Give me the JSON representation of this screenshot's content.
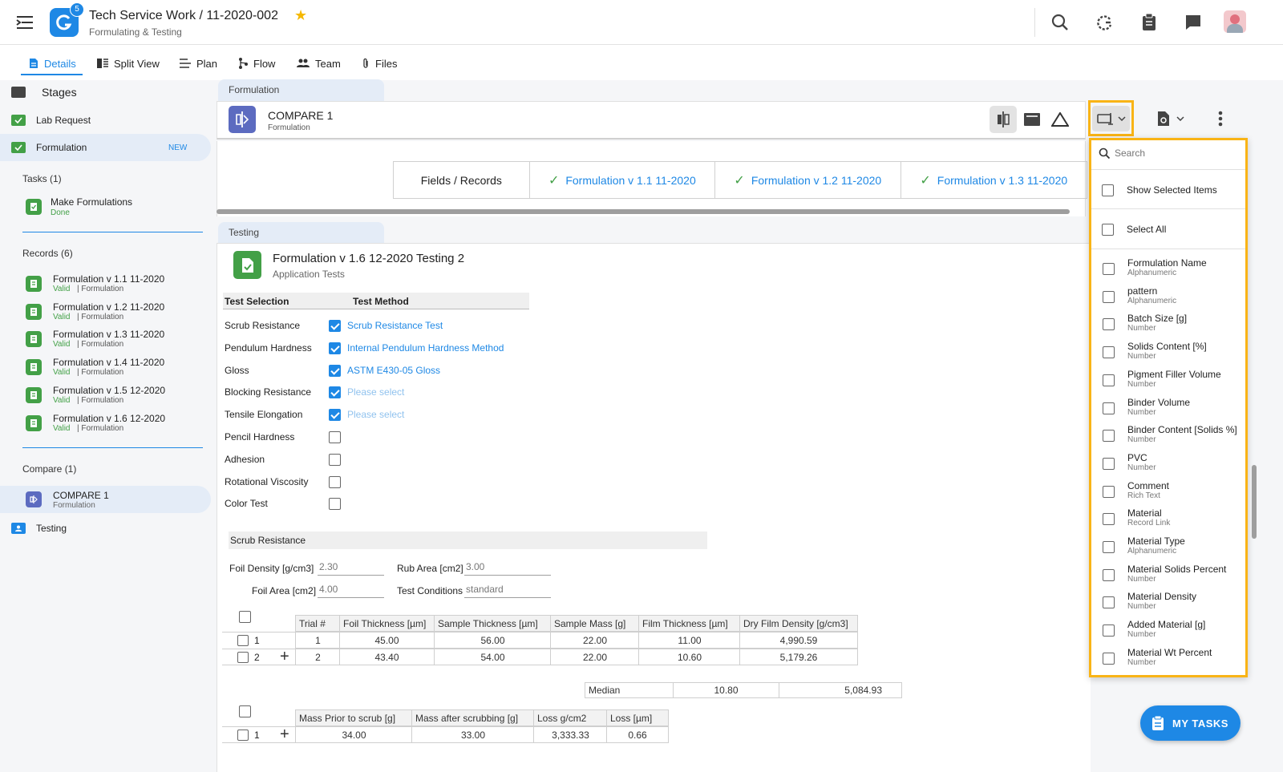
{
  "app": {
    "title": "Tech Service Work / 11-2020-002",
    "subtitle": "Formulating & Testing",
    "notification_count": "5"
  },
  "tabs": [
    {
      "label": "Details",
      "icon": "document-icon"
    },
    {
      "label": "Split View",
      "icon": "split-view-icon"
    },
    {
      "label": "Plan",
      "icon": "plan-icon"
    },
    {
      "label": "Flow",
      "icon": "flow-icon"
    },
    {
      "label": "Team",
      "icon": "team-icon"
    },
    {
      "label": "Files",
      "icon": "paperclip-icon"
    }
  ],
  "sidebar": {
    "stages_title": "Stages",
    "stages": [
      {
        "label": "Lab Request"
      },
      {
        "label": "Formulation",
        "badge": "NEW"
      }
    ],
    "tasks_title": "Tasks (1)",
    "tasks": [
      {
        "name": "Make Formulations",
        "status": "Done"
      }
    ],
    "records_title": "Records (6)",
    "records": [
      {
        "name": "Formulation v 1.1 11-2020",
        "status": "Valid",
        "type": "| Formulation"
      },
      {
        "name": "Formulation v 1.2 11-2020",
        "status": "Valid",
        "type": "| Formulation"
      },
      {
        "name": "Formulation v 1.3 11-2020",
        "status": "Valid",
        "type": "| Formulation"
      },
      {
        "name": "Formulation v 1.4 11-2020",
        "status": "Valid",
        "type": "| Formulation"
      },
      {
        "name": "Formulation v 1.5 12-2020",
        "status": "Valid",
        "type": "| Formulation"
      },
      {
        "name": "Formulation v 1.6 12-2020",
        "status": "Valid",
        "type": "| Formulation"
      }
    ],
    "compare_title": "Compare (1)",
    "compare": {
      "name": "COMPARE 1",
      "type": "Formulation"
    },
    "testing_stage": "Testing"
  },
  "formulation_section": {
    "tab_label": "Formulation",
    "compare_title": "COMPARE 1",
    "compare_subtitle": "Formulation",
    "table_headers": [
      "Fields / Records",
      "Formulation v 1.1 11-2020",
      "Formulation v 1.2 11-2020",
      "Formulation v 1.3 11-2020"
    ]
  },
  "testing_section": {
    "tab_label": "Testing",
    "record_title": "Formulation v 1.6 12-2020 Testing 2",
    "record_subtitle": "Application Tests",
    "test_headers": [
      "Test Selection",
      "Test Method"
    ],
    "tests": [
      {
        "name": "Scrub Resistance",
        "checked": true,
        "method": "Scrub Resistance Test"
      },
      {
        "name": "Pendulum Hardness",
        "checked": true,
        "method": "Internal Pendulum Hardness Method"
      },
      {
        "name": "Gloss",
        "checked": true,
        "method": "ASTM E430-05 Gloss"
      },
      {
        "name": "Blocking Resistance",
        "checked": true,
        "method": "Please select"
      },
      {
        "name": "Tensile Elongation",
        "checked": true,
        "method": "Please select"
      },
      {
        "name": "Pencil Hardness",
        "checked": false,
        "method": ""
      },
      {
        "name": "Adhesion",
        "checked": false,
        "method": ""
      },
      {
        "name": "Rotational Viscosity",
        "checked": false,
        "method": ""
      },
      {
        "name": "Color Test",
        "checked": false,
        "method": ""
      }
    ],
    "scrub": {
      "title": "Scrub Resistance",
      "foil_density_label": "Foil Density [g/cm3]",
      "foil_density": "2.30",
      "rub_area_label": "Rub Area [cm2]",
      "rub_area": "3.00",
      "foil_area_label": "Foil Area [cm2]",
      "foil_area": "4.00",
      "test_conditions_label": "Test Conditions",
      "test_conditions": "standard",
      "trial_headers": [
        "Trial #",
        "Foil Thickness [µm]",
        "Sample Thickness [µm]",
        "Sample Mass [g]",
        "Film Thickness [µm]",
        "Dry Film Density [g/cm3]"
      ],
      "trials": [
        {
          "row": "1",
          "values": [
            "1",
            "45.00",
            "56.00",
            "22.00",
            "11.00",
            "4,990.59"
          ]
        },
        {
          "row": "2",
          "values": [
            "2",
            "43.40",
            "54.00",
            "22.00",
            "10.60",
            "5,179.26"
          ]
        }
      ],
      "median_label": "Median",
      "median_film": "10.80",
      "median_density": "5,084.93",
      "mass_headers": [
        "Mass Prior to scrub [g]",
        "Mass after scrubbing [g]",
        "Loss g/cm2",
        "Loss [µm]"
      ],
      "mass_rows": [
        {
          "row": "1",
          "values": [
            "34.00",
            "33.00",
            "3,333.33",
            "0.66"
          ]
        }
      ]
    }
  },
  "dropdown": {
    "search_placeholder": "Search",
    "show_selected": "Show Selected Items",
    "select_all": "Select All",
    "items": [
      {
        "name": "Formulation Name",
        "type": "Alphanumeric"
      },
      {
        "name": "pattern",
        "type": "Alphanumeric"
      },
      {
        "name": "Batch Size [g]",
        "type": "Number"
      },
      {
        "name": "Solids Content [%]",
        "type": "Number"
      },
      {
        "name": "Pigment Filler Volume",
        "type": "Number"
      },
      {
        "name": "Binder Volume",
        "type": "Number"
      },
      {
        "name": "Binder Content [Solids %]",
        "type": "Number"
      },
      {
        "name": "PVC",
        "type": "Number"
      },
      {
        "name": "Comment",
        "type": "Rich Text"
      },
      {
        "name": "Material",
        "type": "Record Link"
      },
      {
        "name": "Material Type",
        "type": "Alphanumeric"
      },
      {
        "name": "Material Solids Percent",
        "type": "Number"
      },
      {
        "name": "Material Density",
        "type": "Number"
      },
      {
        "name": "Added Material [g]",
        "type": "Number"
      },
      {
        "name": "Material Wt Percent",
        "type": "Number"
      }
    ]
  },
  "fab": {
    "label": "MY TASKS"
  },
  "colors": {
    "accent": "#1e88e5",
    "success": "#43a047",
    "highlight": "#f9b416",
    "compare": "#5c6bc0"
  }
}
